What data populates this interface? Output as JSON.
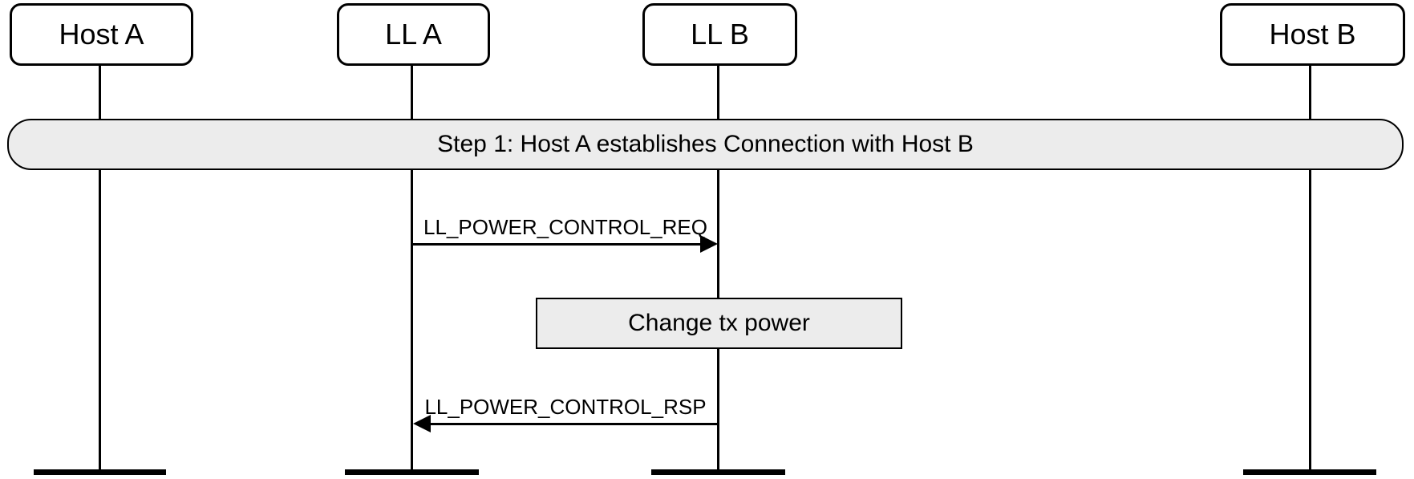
{
  "participants": {
    "host_a": "Host A",
    "ll_a": "LL A",
    "ll_b": "LL B",
    "host_b": "Host B"
  },
  "step1": "Step 1:  Host A establishes Connection with Host B",
  "messages": {
    "req": "LL_POWER_CONTROL_REQ",
    "rsp": "LL_POWER_CONTROL_RSP"
  },
  "action": "Change tx power"
}
